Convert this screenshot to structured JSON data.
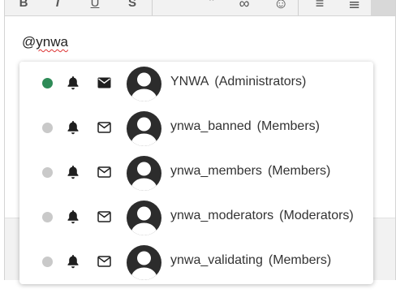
{
  "editor": {
    "toolbar": {
      "buttons": [
        {
          "name": "bold-icon",
          "glyph": "B"
        },
        {
          "name": "italic-icon",
          "glyph": "I"
        },
        {
          "name": "underline-icon",
          "glyph": "U"
        },
        {
          "name": "strikethrough-icon",
          "glyph": "S"
        },
        {
          "name": "quote-icon",
          "glyph": "”"
        },
        {
          "name": "link-icon",
          "glyph": "∞"
        },
        {
          "name": "emoji-icon",
          "glyph": "☺"
        },
        {
          "name": "list-icon",
          "glyph": "≡"
        },
        {
          "name": "ordered-list-icon",
          "glyph": "≣"
        }
      ]
    },
    "content": "@ynwa",
    "content_prefix": "@",
    "content_query": "ynwa"
  },
  "mention": {
    "items": [
      {
        "username": "YNWA",
        "group": "(Administrators)",
        "online": true,
        "status_color": "#2e8b57",
        "mail_icon": "envelope-filled-icon"
      },
      {
        "username": "ynwa_banned",
        "group": "(Members)",
        "online": false,
        "status_color": "#c9c9c9",
        "mail_icon": "envelope-outline-icon"
      },
      {
        "username": "ynwa_members",
        "group": "(Members)",
        "online": false,
        "status_color": "#c9c9c9",
        "mail_icon": "envelope-outline-icon"
      },
      {
        "username": "ynwa_moderators",
        "group": "(Moderators)",
        "online": false,
        "status_color": "#c9c9c9",
        "mail_icon": "envelope-outline-icon"
      },
      {
        "username": "ynwa_validating",
        "group": "(Members)",
        "online": false,
        "status_color": "#c9c9c9",
        "mail_icon": "envelope-outline-icon"
      }
    ]
  }
}
